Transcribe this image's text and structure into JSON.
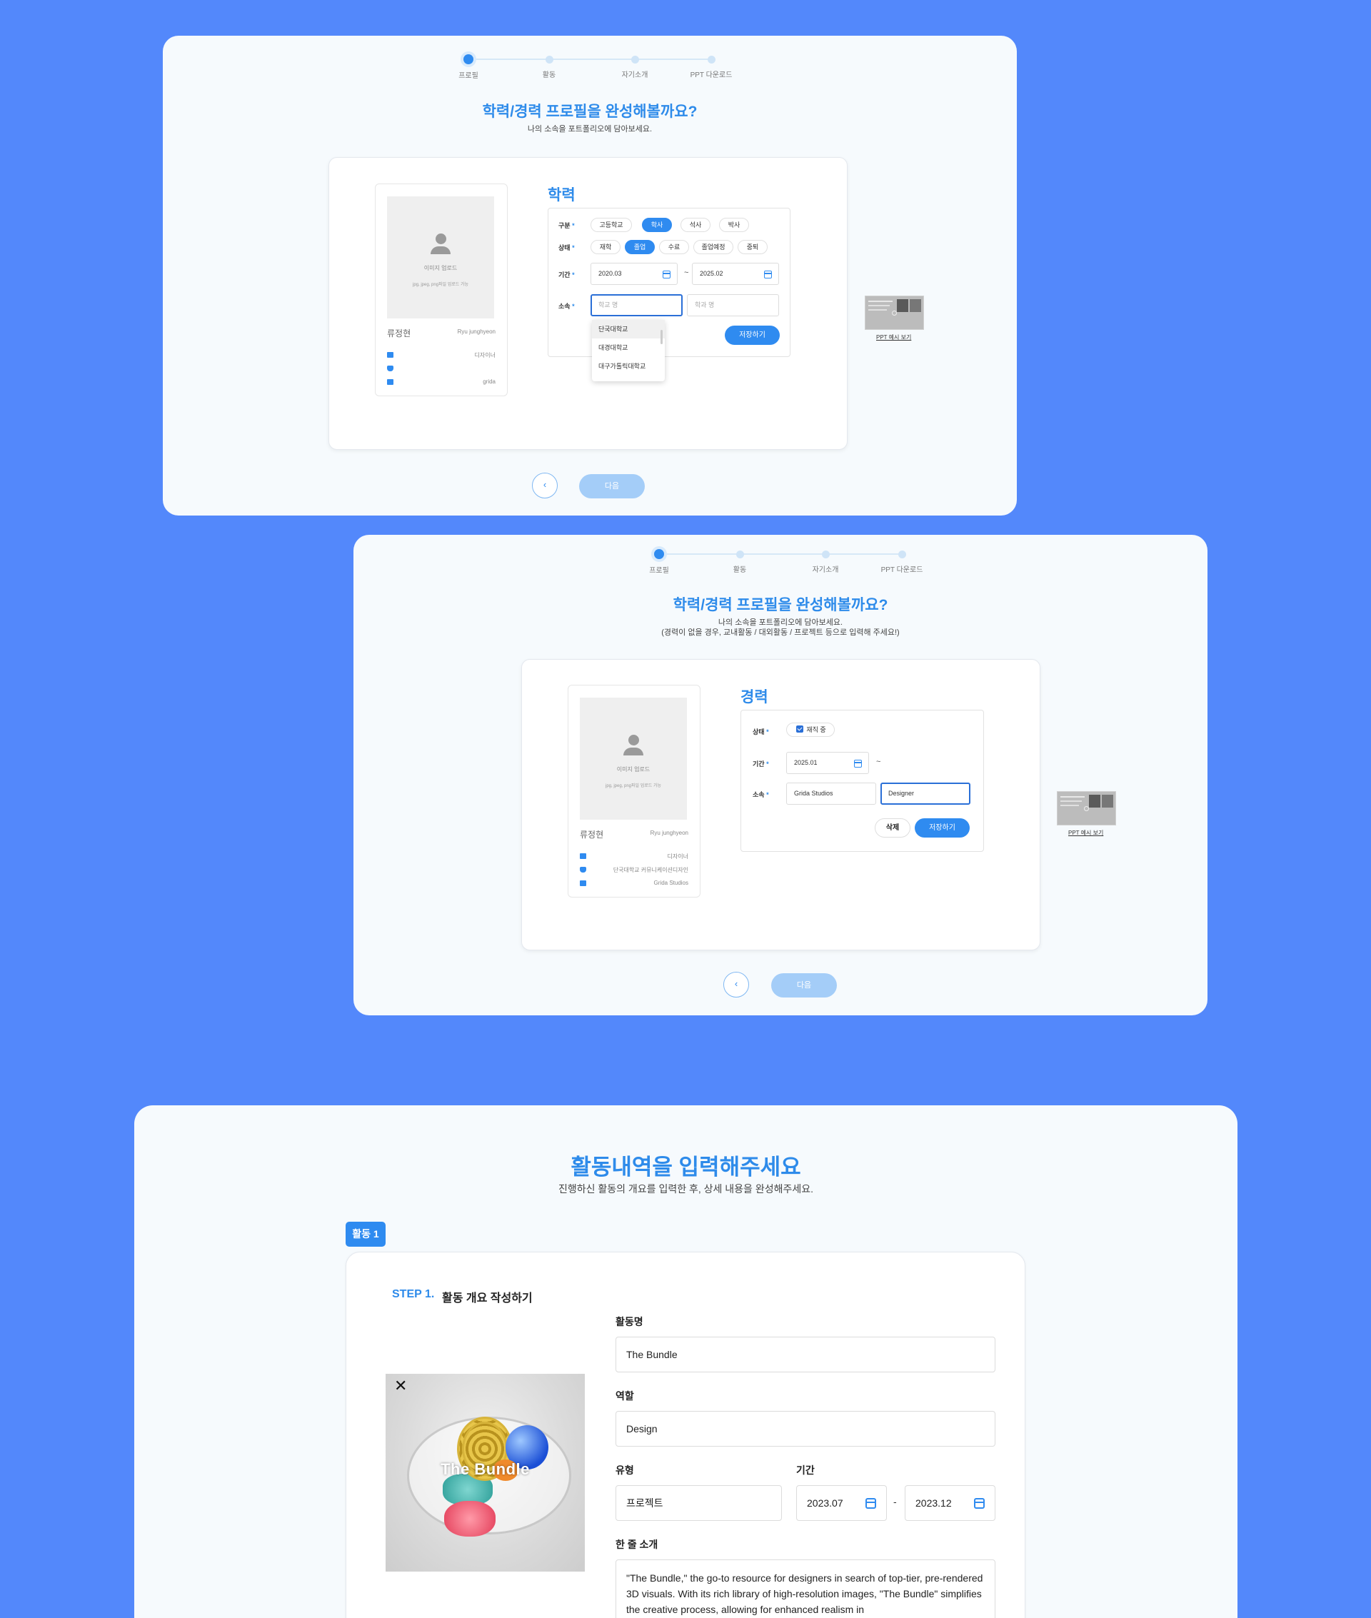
{
  "stepper": {
    "steps": [
      "프로필",
      "활동",
      "자기소개",
      "PPT 다운로드"
    ]
  },
  "panel1": {
    "title": "학력/경력 프로필을 완성해볼까요?",
    "subtitle": "나의 소속을 포트폴리오에 담아보세요.",
    "profile": {
      "upload_title": "이미지 업로드",
      "upload_hint": "jpg, jpeg, png파일 업로드 가능",
      "name": "류정현",
      "name_en": "Ryu junghyeon",
      "job": "디자이너",
      "school": "",
      "company": "grida"
    },
    "section_title": "학력",
    "labels": {
      "category": "구분",
      "status": "상태",
      "period": "기간",
      "affiliation": "소속",
      "required": "*"
    },
    "category_options": [
      "고등학교",
      "학사",
      "석사",
      "박사"
    ],
    "category_selected": "학사",
    "status_options": [
      "재학",
      "졸업",
      "수료",
      "졸업예정",
      "중퇴"
    ],
    "status_selected": "졸업",
    "period_start": "2020.03",
    "period_sep": "~",
    "period_end": "2025.02",
    "school_placeholder": "학교 명",
    "major_placeholder": "학과 명",
    "dropdown": [
      "단국대학교",
      "대경대학교",
      "대구가톨릭대학교"
    ],
    "save_label": "저장하기",
    "ppt_link": "PPT 예시 보기",
    "back_label": "‹",
    "next_label": "다음"
  },
  "panel2": {
    "title": "학력/경력 프로필을 완성해볼까요?",
    "subtitle_1": "나의 소속을 포트폴리오에 담아보세요.",
    "subtitle_2": "(경력이 없을 경우, 교내활동 / 대외활동 / 프로젝트 등으로 입력해 주세요!)",
    "profile": {
      "upload_title": "이미지 업로드",
      "upload_hint": "jpg, jpeg, png파일 업로드 가능",
      "name": "류정현",
      "name_en": "Ryu junghyeon",
      "job": "디자이너",
      "school": "단국대학교 커뮤니케이션디자인",
      "company": "Grida Studios"
    },
    "section_title": "경력",
    "labels": {
      "status": "상태",
      "period": "기간",
      "affiliation": "소속",
      "required": "*"
    },
    "employed_label": "재직 중",
    "period_start": "2025.01",
    "period_sep": "~",
    "company_value": "Grida Studios",
    "role_value": "Designer",
    "delete_label": "삭제",
    "save_label": "저장하기",
    "ppt_link": "PPT 예시 보기",
    "back_label": "‹",
    "next_label": "다음"
  },
  "panel3": {
    "title": "활동내역을 입력해주세요",
    "subtitle": "진행하신 활동의 개요를 입력한 후, 상세 내용을 완성해주세요.",
    "tag": "활동 1",
    "step_num": "STEP 1.",
    "step_title": "활동 개요 작성하기",
    "image_close": "✕",
    "image_text": "The Bundle",
    "fields": {
      "name_label": "활동명",
      "name_value": "The Bundle",
      "role_label": "역할",
      "role_value": "Design",
      "type_label": "유형",
      "type_value": "프로젝트",
      "period_label": "기간",
      "period_start": "2023.07",
      "period_sep": "-",
      "period_end": "2023.12",
      "intro_label": "한 줄 소개",
      "intro_value": "\"The Bundle,\" the go-to resource for designers in search of top-tier, pre-rendered 3D visuals. With its rich library of high-resolution images, \"The Bundle\" simplifies the creative process, allowing for enhanced realism in"
    }
  },
  "colors": {
    "background": "#5388fb",
    "panel": "#f6fafd",
    "accent": "#2f8bf0",
    "next_disabled": "#a4cdf8"
  }
}
